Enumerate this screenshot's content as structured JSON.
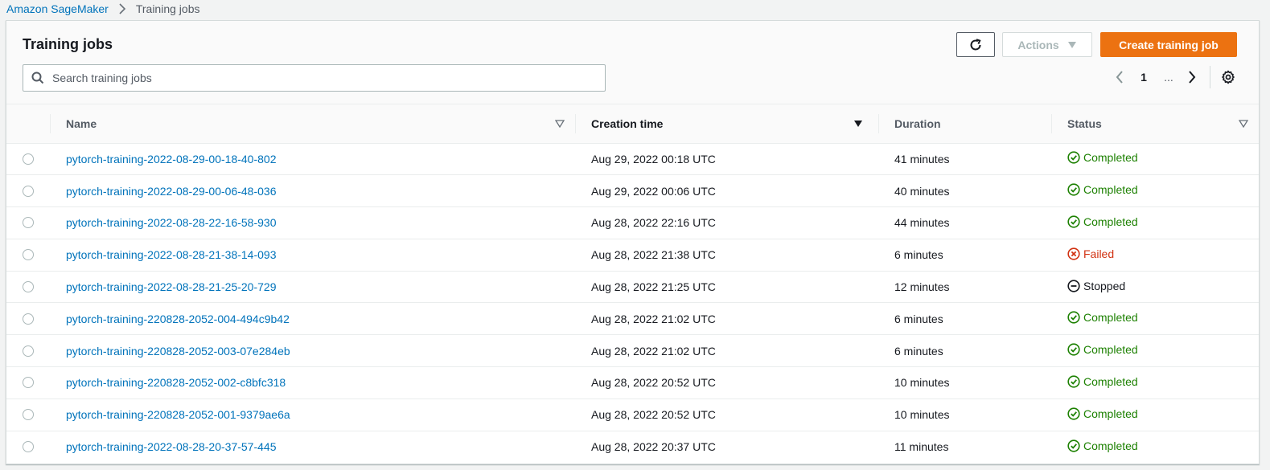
{
  "breadcrumb": {
    "root": "Amazon SageMaker",
    "current": "Training jobs",
    "separator_icon": "chevron-right-icon"
  },
  "panel": {
    "title": "Training jobs",
    "search_placeholder": "Search training jobs",
    "search_value": "",
    "buttons": {
      "refresh_icon": "refresh-icon",
      "actions_label": "Actions",
      "create_label": "Create training job"
    },
    "pagination": {
      "current_page": "1",
      "ellipsis": "..."
    }
  },
  "table": {
    "columns": [
      "Name",
      "Creation time",
      "Duration",
      "Status"
    ],
    "sorted_column": "Creation time",
    "sort_direction": "descending",
    "rows": [
      {
        "name": "pytorch-training-2022-08-29-00-18-40-802",
        "created": "Aug 29, 2022 00:18 UTC",
        "duration": "41 minutes",
        "status": "Completed",
        "status_type": "completed"
      },
      {
        "name": "pytorch-training-2022-08-29-00-06-48-036",
        "created": "Aug 29, 2022 00:06 UTC",
        "duration": "40 minutes",
        "status": "Completed",
        "status_type": "completed"
      },
      {
        "name": "pytorch-training-2022-08-28-22-16-58-930",
        "created": "Aug 28, 2022 22:16 UTC",
        "duration": "44 minutes",
        "status": "Completed",
        "status_type": "completed"
      },
      {
        "name": "pytorch-training-2022-08-28-21-38-14-093",
        "created": "Aug 28, 2022 21:38 UTC",
        "duration": "6 minutes",
        "status": "Failed",
        "status_type": "failed"
      },
      {
        "name": "pytorch-training-2022-08-28-21-25-20-729",
        "created": "Aug 28, 2022 21:25 UTC",
        "duration": "12 minutes",
        "status": "Stopped",
        "status_type": "stopped"
      },
      {
        "name": "pytorch-training-220828-2052-004-494c9b42",
        "created": "Aug 28, 2022 21:02 UTC",
        "duration": "6 minutes",
        "status": "Completed",
        "status_type": "completed"
      },
      {
        "name": "pytorch-training-220828-2052-003-07e284eb",
        "created": "Aug 28, 2022 21:02 UTC",
        "duration": "6 minutes",
        "status": "Completed",
        "status_type": "completed"
      },
      {
        "name": "pytorch-training-220828-2052-002-c8bfc318",
        "created": "Aug 28, 2022 20:52 UTC",
        "duration": "10 minutes",
        "status": "Completed",
        "status_type": "completed"
      },
      {
        "name": "pytorch-training-220828-2052-001-9379ae6a",
        "created": "Aug 28, 2022 20:52 UTC",
        "duration": "10 minutes",
        "status": "Completed",
        "status_type": "completed"
      },
      {
        "name": "pytorch-training-2022-08-28-20-37-57-445",
        "created": "Aug 28, 2022 20:37 UTC",
        "duration": "11 minutes",
        "status": "Completed",
        "status_type": "completed"
      }
    ]
  },
  "colors": {
    "link": "#0073bb",
    "primary_button": "#ec7211",
    "completed": "#1d8102",
    "failed": "#d13212",
    "stopped": "#16191f"
  }
}
